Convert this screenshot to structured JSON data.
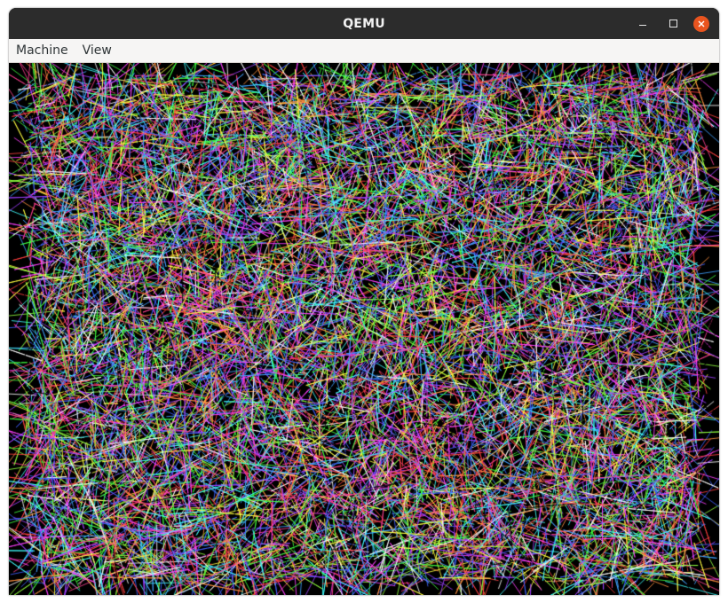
{
  "window": {
    "title": "QEMU",
    "controls": {
      "minimize": "minimize-icon",
      "maximize": "maximize-icon",
      "close": "close-icon"
    },
    "close_color": "#e9541f"
  },
  "menubar": {
    "items": [
      {
        "label": "Machine"
      },
      {
        "label": "View"
      }
    ]
  },
  "display": {
    "content": "random multicolored line segments on black background",
    "background_color": "#000000",
    "line_colors": [
      "#ff4040",
      "#40ff40",
      "#4060ff",
      "#ffff40",
      "#ff40ff",
      "#40ffff",
      "#ffffff",
      "#ff9040",
      "#90ff40",
      "#a040ff",
      "#ff4090",
      "#40a0ff",
      "#000000"
    ]
  }
}
